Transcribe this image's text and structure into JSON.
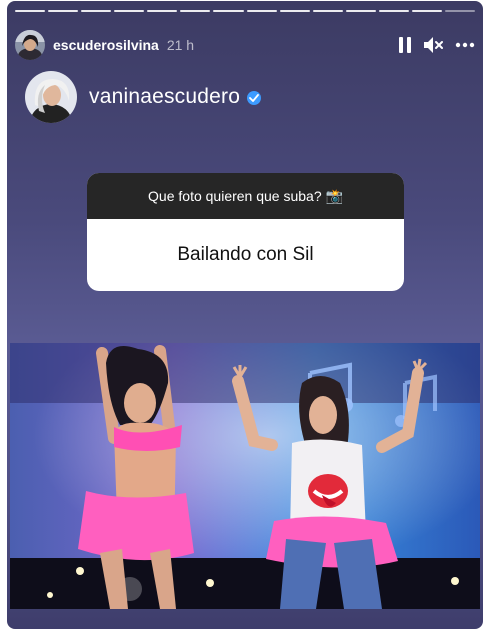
{
  "story": {
    "username": "escuderosilvina",
    "time": "21 h",
    "segments": 14,
    "mention": "vaninaescudero",
    "question": "Que foto quieren que suba? 📸",
    "answer": "Bailando con Sil"
  },
  "icons": [
    "pause-icon",
    "mute-icon",
    "more-icon",
    "verified-icon"
  ],
  "colors": {
    "background": "#4a4a7c",
    "verified": "#3d9bff",
    "question_header": "#262626"
  }
}
